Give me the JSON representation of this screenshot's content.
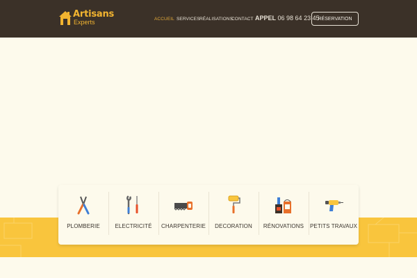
{
  "brand": {
    "title": "Artisans",
    "subtitle": "Experts",
    "icon": "house-icon",
    "color": "#f2b430"
  },
  "nav": {
    "items": [
      {
        "label": "ACCUEIL",
        "active": true
      },
      {
        "label": "SERVICES",
        "active": false
      },
      {
        "label": "RÉALISATIONS",
        "active": false
      },
      {
        "label": "CONTACT",
        "active": false
      }
    ]
  },
  "contact": {
    "call_label": "APPEL",
    "phone": "06 98 64 23 45"
  },
  "header": {
    "reservation_label": "RÉSERVATION",
    "background": "#3b3128"
  },
  "services": [
    {
      "label": "PLOMBERIE",
      "icon": "pliers-icon"
    },
    {
      "label": "ELECTRICITÉ",
      "icon": "wrench-screwdriver-icon"
    },
    {
      "label": "CHARPENTERIE",
      "icon": "saw-icon"
    },
    {
      "label": "DECORATION",
      "icon": "paint-roller-icon"
    },
    {
      "label": "RÉNOVATIONS",
      "icon": "paint-cans-icon"
    },
    {
      "label": "PETITS TRAVAUX",
      "icon": "drill-icon"
    }
  ],
  "colors": {
    "accent": "#f9c53d",
    "background": "#fdfaec",
    "active_nav": "#e2a93a"
  }
}
